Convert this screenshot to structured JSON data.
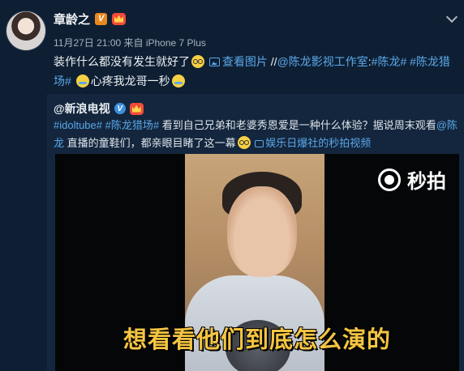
{
  "post": {
    "author": "章龄之",
    "meta": "11月27日 21:00 来自 iPhone 7 Plus",
    "text_before": "装作什么都没有发生就好了",
    "view_pic": "查看图片",
    "text_mid": "//",
    "mention": "@陈龙影视工作室",
    "colon": ":",
    "tag1": "#陈龙#",
    "tag2": "#陈龙猎场#",
    "text_end": "心疼我龙哥一秒"
  },
  "repost": {
    "author": "@新浪电视",
    "tag1": "#idoltube#",
    "tag2": "#陈龙猎场#",
    "text1": "看到自己兄弟和老婆秀恩爱是一种什么体验？据说周末观看",
    "mention": "@陈龙",
    "text2": "直播的童鞋们，都亲眼目睹了这一幕",
    "video_link": "娱乐日爆社的秒拍视频"
  },
  "video": {
    "watermark": "秒拍",
    "subtitle": "想看看他们到底怎么演的"
  }
}
